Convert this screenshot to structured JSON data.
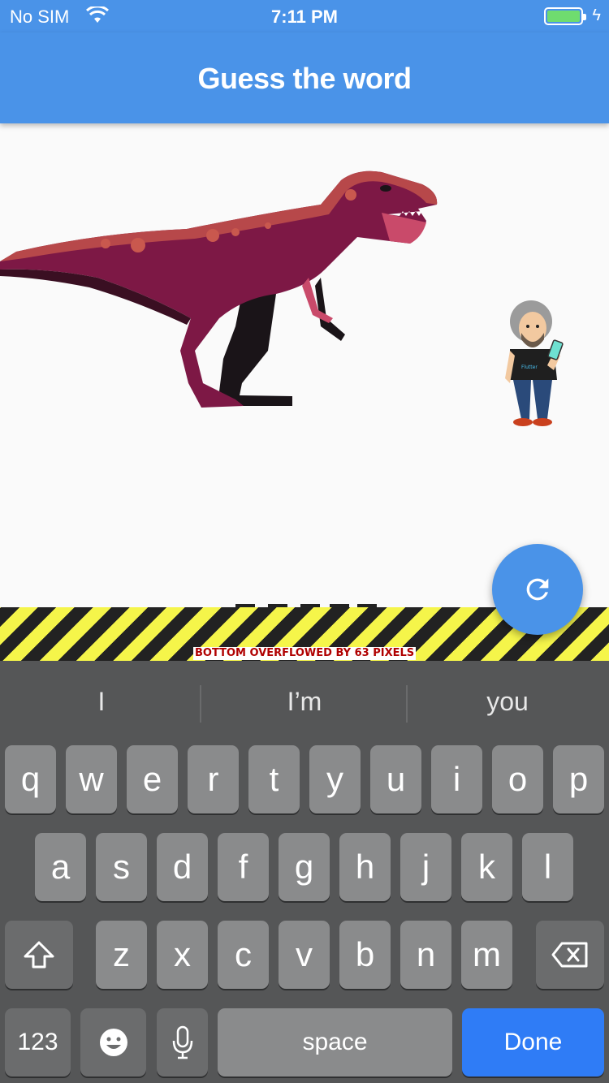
{
  "status_bar": {
    "carrier": "No SIM",
    "time": "7:11 PM"
  },
  "app_bar": {
    "title": "Guess the word"
  },
  "overflow_warning": "BOTTOM OVERFLOWED BY 63 PIXELS",
  "fab": {
    "icon": "refresh-icon"
  },
  "colors": {
    "primary": "#4a93e8",
    "keyboard_bg": "#555657",
    "key": "#8a8b8c",
    "done": "#2f7cf6"
  },
  "keyboard": {
    "suggestions": [
      "I",
      "I’m",
      "you"
    ],
    "row1": [
      "q",
      "w",
      "e",
      "r",
      "t",
      "y",
      "u",
      "i",
      "o",
      "p"
    ],
    "row2": [
      "a",
      "s",
      "d",
      "f",
      "g",
      "h",
      "j",
      "k",
      "l"
    ],
    "row3": [
      "z",
      "x",
      "c",
      "v",
      "b",
      "n",
      "m"
    ],
    "numbers_label": "123",
    "space_label": "space",
    "done_label": "Done"
  }
}
